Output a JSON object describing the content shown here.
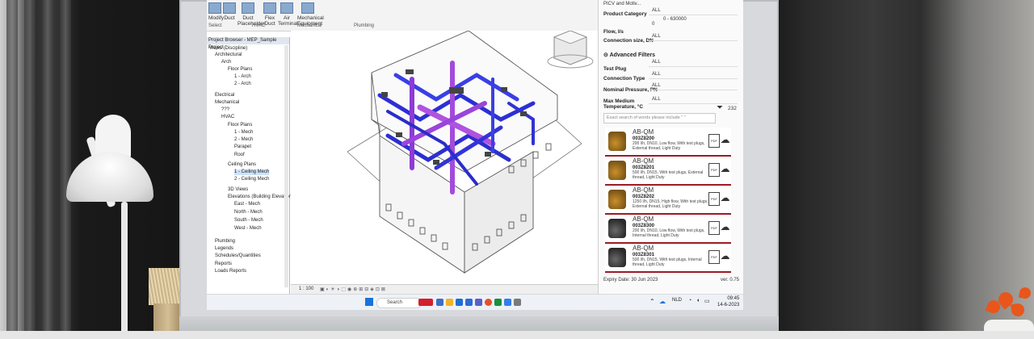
{
  "ribbon": {
    "tools": [
      "Modify",
      "Duct",
      "Duct Placeholder",
      "Flex Duct",
      "Air Terminal",
      "Mechanical Equipment"
    ],
    "groups": [
      "Select",
      "HVAC",
      "Mechanical",
      "Plumbing"
    ]
  },
  "project_browser": {
    "title": "Project Browser - MEP_Sample Project",
    "items": [
      "Views (Discipline)",
      "Architectural",
      "Arch",
      "Floor Plans",
      "1 - Arch",
      "2 - Arch",
      "Electrical",
      "Mechanical",
      "???",
      "HVAC",
      "Floor Plans",
      "1 - Mech",
      "2 - Mech",
      "Parapet",
      "Roof",
      "Ceiling Plans",
      "1 - Ceiling Mech",
      "2 - Ceiling Mech",
      "3D Views",
      "Elevations (Building Elevation)",
      "East - Mech",
      "North - Mech",
      "South - Mech",
      "West - Mech",
      "Plumbing",
      "Legends",
      "Schedules/Quantities",
      "Reports",
      "Loads Reports"
    ]
  },
  "viewport": {
    "scale": "1 : 100"
  },
  "panel": {
    "top_label": "PICV and Motiv...",
    "filters": [
      {
        "label": "Product Category",
        "value": "ALL"
      },
      {
        "label": "Flow, l/s",
        "value": "0 - 630000"
      },
      {
        "label": "Connection size, DN",
        "value": "ALL"
      }
    ],
    "flow_min": "0",
    "advanced_title": "Advanced Filters",
    "advanced": [
      {
        "label": "Test Plug",
        "value": "ALL"
      },
      {
        "label": "Connection Type",
        "value": "ALL"
      },
      {
        "label": "Nominal Pressure, PN",
        "value": "ALL"
      },
      {
        "label": "Max Medium Temperature, °C",
        "value": "ALL"
      }
    ],
    "result_count": "232",
    "search_placeholder": "Exact search of words please include \" \"",
    "products": [
      {
        "brand": "AB-QM",
        "code": "003Z8200",
        "desc": "200 l/h, DN10, Low flow, With test plugs, External thread, Light Duty"
      },
      {
        "brand": "AB-QM",
        "code": "003Z8201",
        "desc": "500 l/h, DN15, With test plugs, External thread, Light Duty"
      },
      {
        "brand": "AB-QM",
        "code": "003Z8202",
        "desc": "1250 l/h, DN15, High flow, With test plugs, External thread, Light Duty"
      },
      {
        "brand": "AB-QM",
        "code": "003Z8300",
        "desc": "200 l/h, DN10, Low flow, With test plugs, Internal thread, Light Duty"
      },
      {
        "brand": "AB-QM",
        "code": "003Z8301",
        "desc": "500 l/h, DN15, With test plugs, Internal thread, Light Duty"
      }
    ],
    "expiry": "Expiry Date: 30 Jun 2023",
    "version": "ver. 0.75"
  },
  "taskbar": {
    "search": "Search",
    "lang": "NLD",
    "time": "09:45",
    "date": "14-6-2023"
  }
}
